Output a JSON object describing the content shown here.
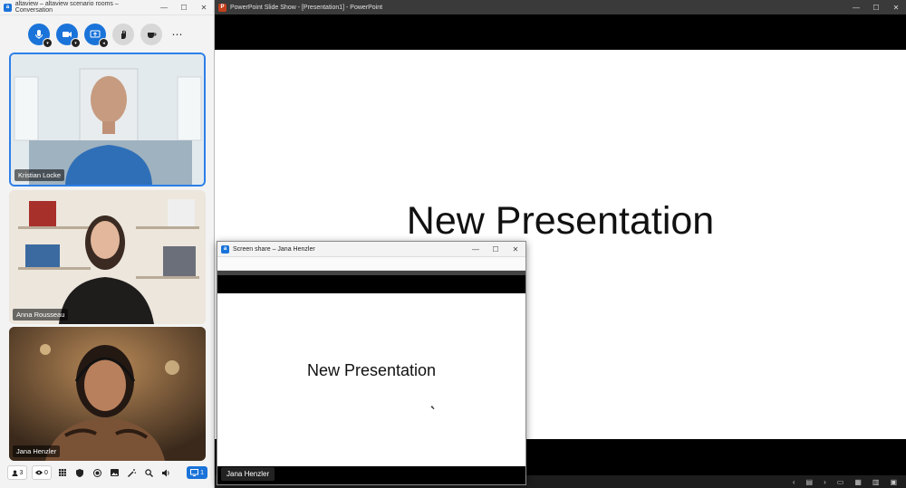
{
  "conversation": {
    "title": "altaview – altaview scenario rooms – Conversation",
    "toolbar": [
      "microphone-icon",
      "video-camera-icon",
      "screen-share-icon",
      "raise-hand-icon",
      "coffee-break-icon",
      "more-icon"
    ],
    "more_label": "⋯",
    "participants": [
      {
        "name": "Kristian Locke"
      },
      {
        "name": "Anna Rousseau"
      },
      {
        "name": "Jana Henzler"
      }
    ],
    "bottombar": {
      "participants_count": "3",
      "viewers_count": "0",
      "share_count": "1"
    },
    "colors": {
      "accent": "#1a73d9",
      "active_border": "#2b7fe8"
    }
  },
  "powerpoint": {
    "title": "PowerPoint Slide Show - [Presentation1] - PowerPoint",
    "slide_title": "New Presentation"
  },
  "screenshare": {
    "title": "Screen share – Jana Henzler",
    "slide_title": "New Presentation",
    "presenter": "Jana Henzler"
  }
}
